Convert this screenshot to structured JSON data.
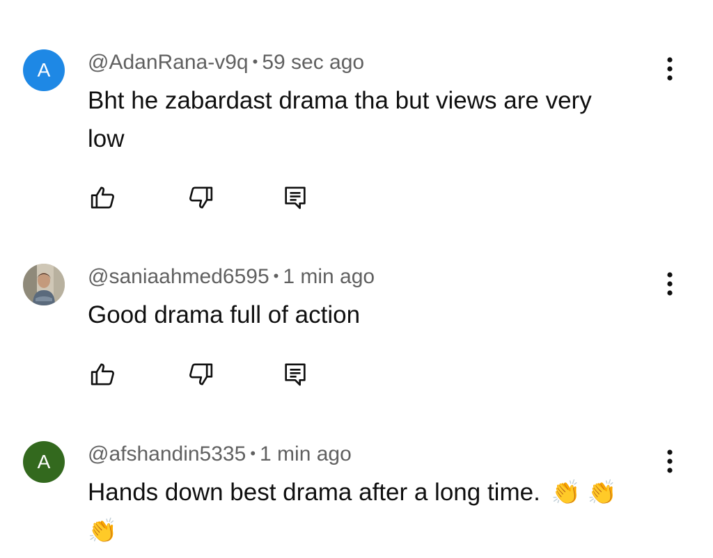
{
  "comments": [
    {
      "avatar_letter": "A",
      "avatar_color": "#1e88e5",
      "handle": "@AdanRana-v9q",
      "separator": "•",
      "time": "59 sec ago",
      "text_line1": "Bht he zabardast drama tha but views are very",
      "text_line2": "low"
    },
    {
      "avatar_letter": "",
      "avatar_color": "#c9c2b4",
      "handle": "@saniaahmed6595",
      "separator": "•",
      "time": "1 min ago",
      "text_line1": "Good drama full of action"
    },
    {
      "avatar_letter": "A",
      "avatar_color": "#33691e",
      "handle": "@afshandin5335",
      "separator": "•",
      "time": "1 min ago",
      "text_line1": "Hands down best drama after a long time.",
      "emojis": [
        "👏",
        "👏",
        "👏"
      ]
    }
  ],
  "icons": {
    "like": "thumbs-up-icon",
    "dislike": "thumbs-down-icon",
    "reply": "reply-comment-icon",
    "more": "more-vert-icon"
  }
}
